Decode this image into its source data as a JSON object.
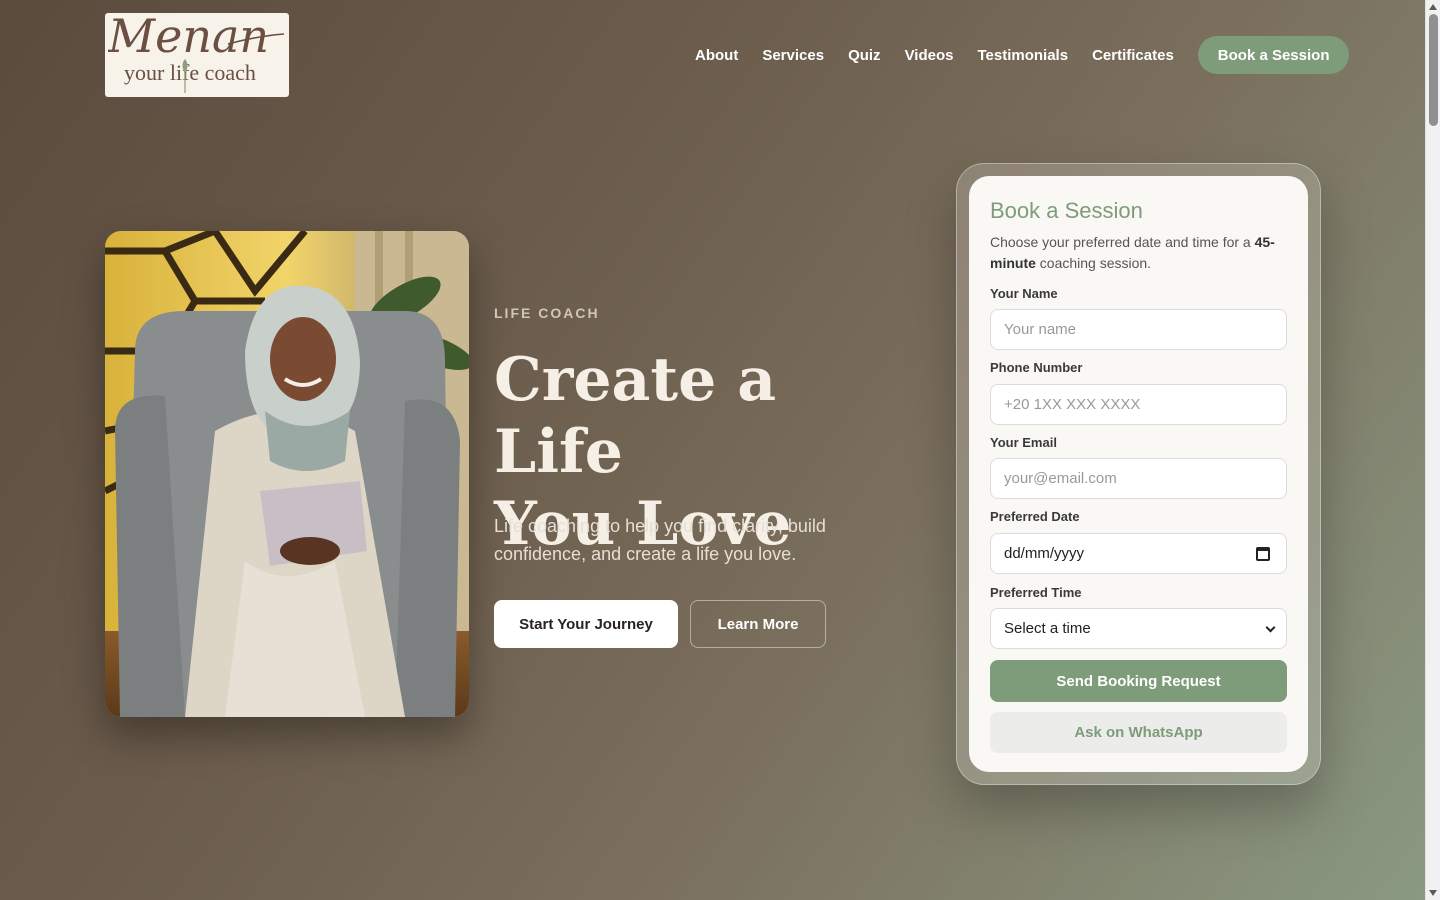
{
  "logo": {
    "script": "Menan",
    "sub": "your life coach"
  },
  "nav": {
    "links": [
      "About",
      "Services",
      "Quiz",
      "Videos",
      "Testimonials",
      "Certificates"
    ],
    "cta": "Book a Session"
  },
  "hero": {
    "eyebrow": "LIFE COACH",
    "title_line1": "Create a Life",
    "title_line2": "You Love",
    "lead": "Life coaching to help you find clarity, build confidence, and create a life you love.",
    "primary_button": "Start Your Journey",
    "secondary_button": "Learn More",
    "photo_icon": "coach-portrait"
  },
  "booking": {
    "title": "Book a Session",
    "desc_before": "Choose your preferred date and time for a ",
    "desc_bold": "45-minute",
    "desc_after": " coaching session.",
    "name_label": "Your Name",
    "name_placeholder": "Your name",
    "phone_label": "Phone Number",
    "phone_placeholder": "+20 1XX XXX XXXX",
    "email_label": "Your Email",
    "email_placeholder": "your@email.com",
    "date_label": "Preferred Date",
    "date_value": "dd/mm/yyyy",
    "time_label": "Preferred Time",
    "time_value": "Select a time",
    "send_button": "Send Booking Request",
    "whatsapp_button": "Ask on WhatsApp"
  },
  "colors": {
    "accent": "#7e9c79",
    "logo_bg": "#f7f2ea",
    "card_bg": "#f9f8f5"
  }
}
